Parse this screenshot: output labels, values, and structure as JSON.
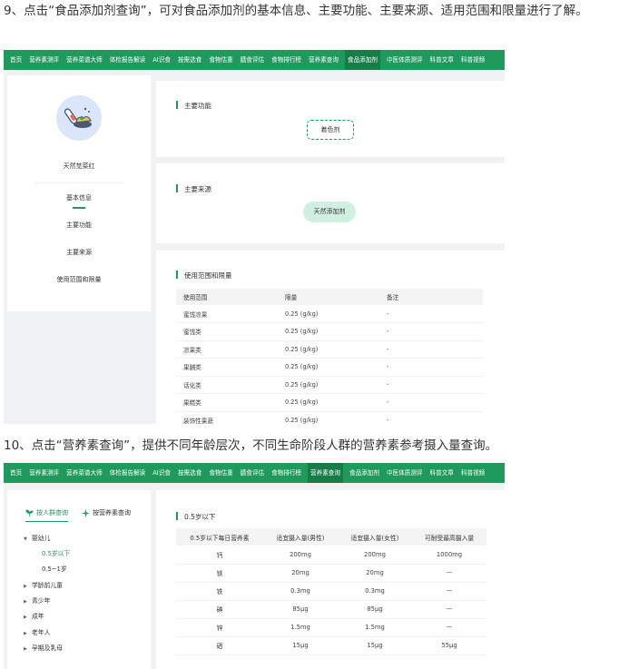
{
  "para9": "9、点击“食品添加剂查询”，可对食品添加剂的基本信息、主要功能、主要来源、适用范围和限量进行了解。",
  "para10": "10、点击“营养素查询”，提供不同年龄层次，不同生命阶段人群的营养素参考摄入量查询。",
  "nav1": [
    "首页",
    "营养素测评",
    "营养菜谱大师",
    "体检报告解读",
    "AI识食",
    "按需选食",
    "食物估重",
    "膳食评估",
    "食物排行榜",
    "营养素查询",
    "食品添加剂",
    "中医体质测评",
    "科普文章",
    "科普视频"
  ],
  "nav1_active": 10,
  "nav2": [
    "首页",
    "营养素测评",
    "营养菜谱大师",
    "体检报告解读",
    "AI识食",
    "按需选食",
    "食物估重",
    "膳食评估",
    "食物排行榜",
    "营养素查询",
    "食品添加剂",
    "中医体质测评",
    "科普文章",
    "科普视频"
  ],
  "nav2_active": 9,
  "additive": {
    "name": "天然苋菜红",
    "menu": [
      "基本信息",
      "主要功能",
      "主要来源",
      "使用范围和限量"
    ],
    "function_title": "主要功能",
    "function_tag": "着色剂",
    "source_title": "主要来源",
    "source_tag": "天然添加剂",
    "usage_title": "使用范围和限量",
    "usage_headers": [
      "使用范围",
      "限量",
      "备注"
    ],
    "usage_rows": [
      [
        "蜜饯凉果",
        "0.25 (g/kg)",
        "-"
      ],
      [
        "蜜饯类",
        "0.25 (g/kg)",
        "-"
      ],
      [
        "凉果类",
        "0.25 (g/kg)",
        "-"
      ],
      [
        "果脯类",
        "0.25 (g/kg)",
        "-"
      ],
      [
        "话化类",
        "0.25 (g/kg)",
        "-"
      ],
      [
        "果糕类",
        "0.25 (g/kg)",
        "-"
      ],
      [
        "装饰性果蔬",
        "0.25 (g/kg)",
        "-"
      ]
    ]
  },
  "nutrient": {
    "tab_crowd": "按人群查询",
    "tab_nutrient": "按营养素查询",
    "tree": [
      "婴幼儿",
      "学龄前儿童",
      "青少年",
      "成年",
      "老年人",
      "孕期及乳母"
    ],
    "tree_sub": [
      "0.5岁以下",
      "0.5~1岁"
    ],
    "section_title": "0.5岁以下",
    "headers": [
      "0.5岁以下每日营养素",
      "适宜摄入量(男性)",
      "适宜摄入量(女性)",
      "可耐受最高摄入量"
    ],
    "rows": [
      [
        "钙",
        "200mg",
        "200mg",
        "1000mg"
      ],
      [
        "镁",
        "20mg",
        "20mg",
        "—"
      ],
      [
        "铁",
        "0.3mg",
        "0.3mg",
        "—"
      ],
      [
        "碘",
        "85μg",
        "85μg",
        "—"
      ],
      [
        "锌",
        "1.5mg",
        "1.5mg",
        "—"
      ],
      [
        "硒",
        "15μg",
        "15μg",
        "55μg"
      ]
    ]
  }
}
